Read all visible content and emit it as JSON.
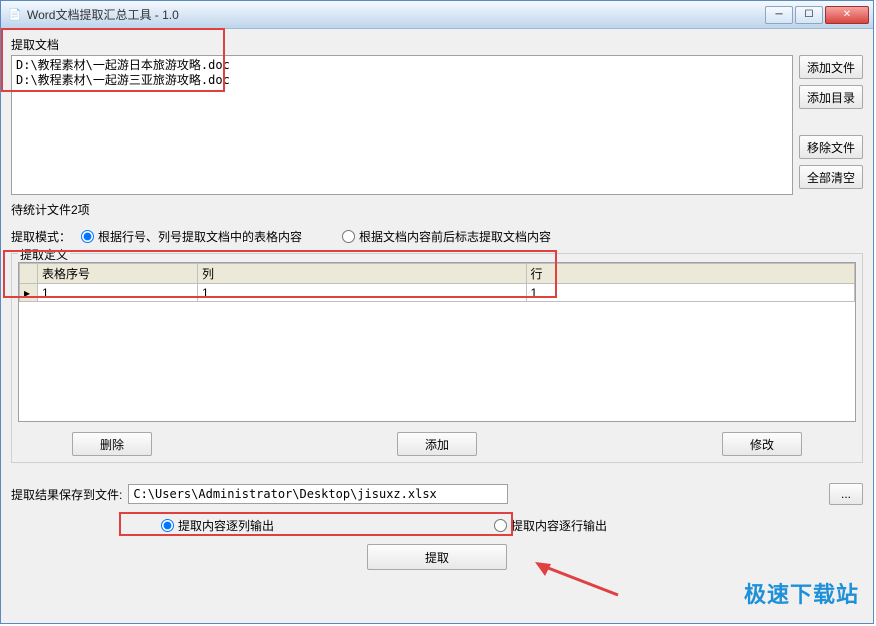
{
  "window": {
    "title": "Word文档提取汇总工具 - 1.0"
  },
  "fileSection": {
    "label": "提取文档",
    "files": [
      "D:\\教程素材\\一起游日本旅游攻略.doc",
      "D:\\教程素材\\一起游三亚旅游攻略.doc"
    ],
    "status": "待统计文件2项"
  },
  "sideButtons": {
    "addFile": "添加文件",
    "addDir": "添加目录",
    "removeFile": "移除文件",
    "clearAll": "全部清空"
  },
  "mode": {
    "label": "提取模式：",
    "opt1": "根据行号、列号提取文档中的表格内容",
    "opt2": "根据文档内容前后标志提取文档内容"
  },
  "definition": {
    "label": "提取定义",
    "headers": {
      "tableIndex": "表格序号",
      "col": "列",
      "row": "行"
    },
    "rows": [
      {
        "tableIndex": "1",
        "col": "1",
        "row": "1"
      }
    ],
    "buttons": {
      "delete": "删除",
      "add": "添加",
      "modify": "修改"
    }
  },
  "save": {
    "label": "提取结果保存到文件:",
    "path": "C:\\Users\\Administrator\\Desktop\\jisuxz.xlsx",
    "browse": "..."
  },
  "output": {
    "byCol": "提取内容逐列输出",
    "byRow": "提取内容逐行输出"
  },
  "action": {
    "extract": "提取"
  },
  "watermark": "极速下载站"
}
